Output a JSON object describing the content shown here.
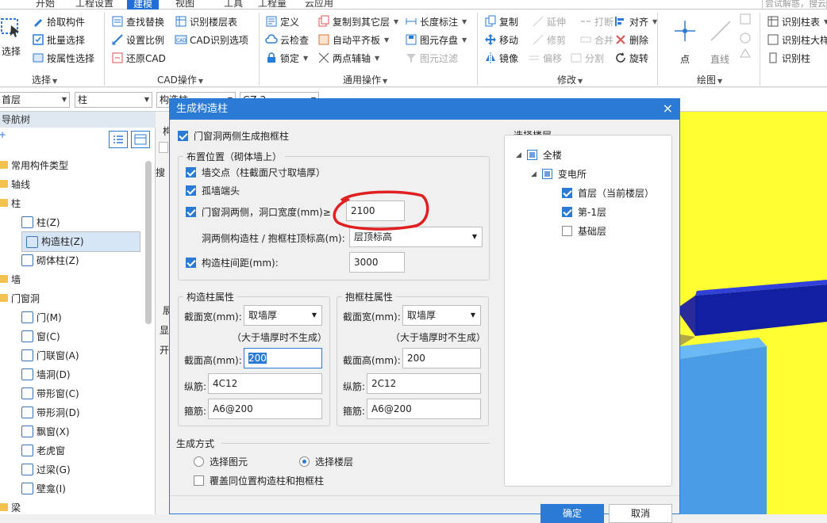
{
  "menu": {
    "items": [
      "开始",
      "工程设置",
      "建模",
      "视图",
      "工具",
      "工程量",
      "云应用"
    ],
    "active_index": 2,
    "search_placeholder": "尝试解惑，搜云"
  },
  "ribbon": {
    "select": {
      "label": "选择",
      "group": "选择"
    },
    "select_group": {
      "items": [
        "拾取构件",
        "批量选择",
        "按属性选择"
      ]
    },
    "cad_group": {
      "label": "CAD操作",
      "items": [
        "查找替换",
        "识别楼层表",
        "设置比例",
        "CAD识别选项",
        "还原CAD"
      ]
    },
    "common_group": {
      "label": "通用操作",
      "items": [
        "定义",
        "复制到其它层",
        "长度标注",
        "云检查",
        "自动平齐板",
        "图元存盘",
        "锁定",
        "两点辅轴",
        "图元过滤"
      ]
    },
    "modify_group": {
      "label": "修改",
      "items": [
        "复制",
        "延伸",
        "打断",
        "对齐",
        "移动",
        "修剪",
        "合并",
        "删除",
        "镜像",
        "偏移",
        "分割",
        "旋转"
      ]
    },
    "draw_group": {
      "label": "绘图",
      "items": [
        "点",
        "直线"
      ]
    },
    "recognize_group": {
      "items": [
        "识别柱表",
        "识别柱大样",
        "识别柱"
      ]
    }
  },
  "row2": {
    "floor_combo": "首层",
    "type_combo": "柱",
    "comp_combo": "构造柱",
    "extra_combo": "GZ-2"
  },
  "leftpanel": {
    "header": "导航树",
    "tree": [
      {
        "label": "常用构件类型",
        "level": 0
      },
      {
        "label": "轴线",
        "level": 0
      },
      {
        "label": "柱",
        "level": 0
      },
      {
        "label": "柱(Z)",
        "level": 1
      },
      {
        "label": "构造柱(Z)",
        "level": 1
      },
      {
        "label": "砌体柱(Z)",
        "level": 1
      },
      {
        "label": "墙",
        "level": 0
      },
      {
        "label": "门窗洞",
        "level": 0
      },
      {
        "label": "门(M)",
        "level": 1
      },
      {
        "label": "窗(C)",
        "level": 1
      },
      {
        "label": "门联窗(A)",
        "level": 1
      },
      {
        "label": "墙洞(D)",
        "level": 1
      },
      {
        "label": "带形窗(C)",
        "level": 1
      },
      {
        "label": "带形洞(D)",
        "level": 1
      },
      {
        "label": "飘窗(X)",
        "level": 1
      },
      {
        "label": "老虎窗",
        "level": 1
      },
      {
        "label": "过梁(G)",
        "level": 1
      },
      {
        "label": "壁龛(I)",
        "level": 1
      },
      {
        "label": "梁",
        "level": 0
      }
    ],
    "selected_index": 4
  },
  "midstrip": {
    "labels": [
      "构",
      "搜",
      "展",
      "显",
      "开"
    ]
  },
  "dialog": {
    "title": "生成构造柱",
    "close": "×",
    "door_window_wrap": "门窗洞两侧生成抱框柱",
    "layout_legend": "布置位置（砌体墙上）",
    "wall_intersection": "墙交点（柱截面尺寸取墙厚）",
    "isolated_end": "孤墙端头",
    "opening_sides": "门窗洞两侧，洞口宽度(mm)≥",
    "opening_width": "2100",
    "top_elev_label": "洞两侧构造柱 / 抱框柱顶标高(m):",
    "top_elev_value": "层顶标高",
    "spacing_label": "构造柱间距(mm):",
    "spacing_value": "3000",
    "gz_legend": "构造柱属性",
    "bk_legend": "抱框柱属性",
    "width_label": "截面宽(mm):",
    "width_value": "取墙厚",
    "width_note": "（大于墙厚时不生成）",
    "height_label": "截面高(mm):",
    "gz_height": "200",
    "bk_height": "200",
    "rebar_label": "纵筋:",
    "gz_rebar": "4C12",
    "bk_rebar": "2C12",
    "stirrup_label": "箍筋:",
    "gz_stirrup": "A6@200",
    "bk_stirrup": "A6@200",
    "mode_legend": "生成方式",
    "mode_select_elem": "选择图元",
    "mode_select_floor": "选择楼层",
    "overwrite": "覆盖同位置构造柱和抱框柱",
    "floor_legend": "选择楼层",
    "floor_all": "全楼",
    "floor_building": "变电所",
    "floor_first": "首层（当前楼层）",
    "floor_minus1": "第-1层",
    "floor_base": "基础层",
    "ok": "确定",
    "cancel": "取消"
  },
  "colors": {
    "accent": "#2b7bd6",
    "viewport_bg": "#ffff33",
    "annotation": "#e02020"
  }
}
